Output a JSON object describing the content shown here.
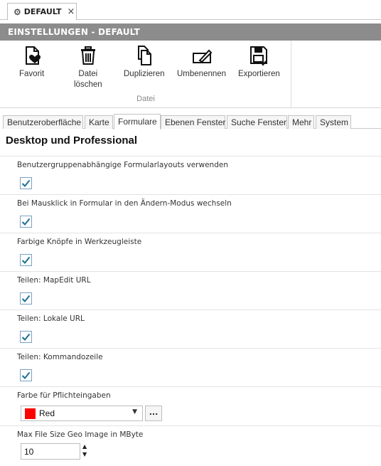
{
  "doc_tab": {
    "title": "DEFAULT",
    "close": "×"
  },
  "header": {
    "title": "EINSTELLUNGEN - DEFAULT"
  },
  "ribbon": {
    "buttons": [
      {
        "label": "Favorit",
        "icon": "favorite-icon"
      },
      {
        "label": "Datei\nlöschen",
        "icon": "trash-icon"
      },
      {
        "label": "Duplizieren",
        "icon": "duplicate-icon"
      },
      {
        "label": "Umbenennen",
        "icon": "rename-icon"
      },
      {
        "label": "Exportieren",
        "icon": "export-icon"
      }
    ],
    "group_label": "Datei"
  },
  "tabs": [
    "Benutzeroberfläche",
    "Karte",
    "Formulare",
    "Ebenen Fenster",
    "Suche Fenster",
    "Mehr",
    "System"
  ],
  "active_tab": "Formulare",
  "section_title": "Desktop und Professional",
  "settings": [
    {
      "label": "Benutzergruppenabhängige Formularlayouts verwenden",
      "checked": true
    },
    {
      "label": "Bei Mausklick in Formular in den Ändern-Modus wechseln",
      "checked": true
    },
    {
      "label": "Farbige Knöpfe in Werkzeugleiste",
      "checked": true
    },
    {
      "label": "Teilen: MapEdit URL",
      "checked": true
    },
    {
      "label": "Teilen: Lokale URL",
      "checked": true
    },
    {
      "label": "Teilen: Kommandozeile",
      "checked": true
    }
  ],
  "color_setting": {
    "label": "Farbe für Pflichteingaben",
    "value": "Red",
    "swatch": "#ff0000",
    "ellipsis": "..."
  },
  "size_setting": {
    "label": "Max File Size Geo Image in MByte",
    "value": "10"
  },
  "colors": {
    "header_bg": "#8c8c8c",
    "check": "#1f6f93"
  }
}
